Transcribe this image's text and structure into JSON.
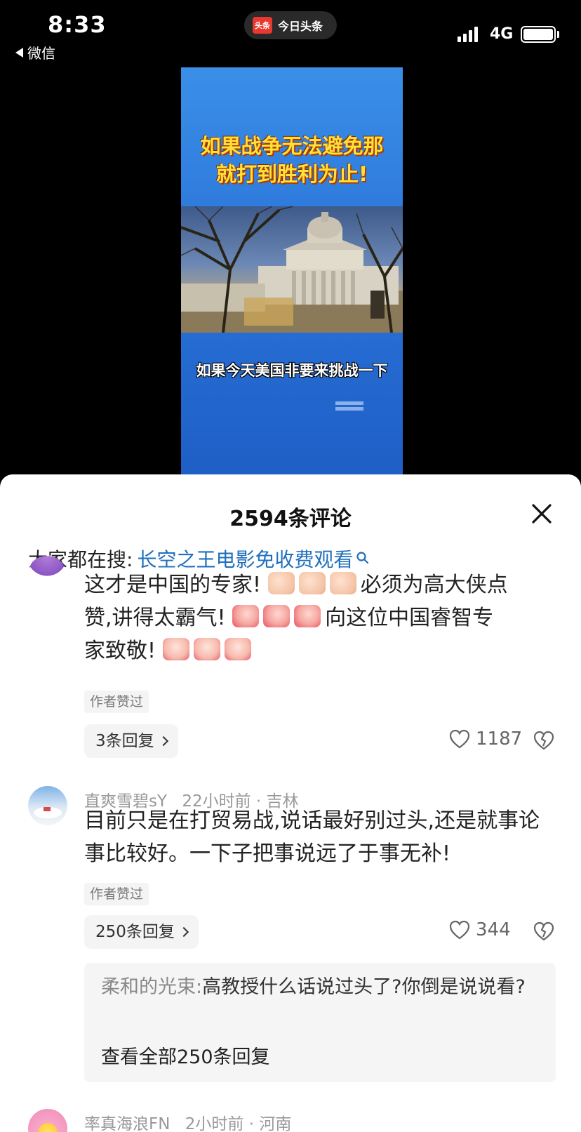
{
  "status_bar": {
    "time": "8:33",
    "back_app": "微信",
    "app_name": "今日头条",
    "app_logo_text": "头条",
    "network": "4G"
  },
  "video": {
    "headline_line1": "如果战争无法避免那",
    "headline_line2": "就打到胜利为止!",
    "subtitle": "如果今天美国非要来挑战一下"
  },
  "comments_sheet": {
    "title": "2594条评论",
    "search_label": "大家都在搜:",
    "search_link": "长空之王电影免收费观看",
    "comments": [
      {
        "text_line1": "这才是中国的专家!",
        "text_line1b": "必须为高大侠点",
        "text_line2a": "赞,讲得太霸气!",
        "text_line2b": "向这位中国睿智专",
        "text_line3": "家致敬!",
        "author_liked": "作者赞过",
        "replies": "3条回复",
        "likes": "1187"
      },
      {
        "username": "直爽雪碧sY",
        "time": "22小时前 · 吉林",
        "text": "目前只是在打贸易战,说话最好别过头,还是就事论事比较好。一下子把事说远了于事无补!",
        "author_liked": "作者赞过",
        "replies": "250条回复",
        "likes": "344",
        "reply_preview": {
          "name": "柔和的光束",
          "separator": ":",
          "text": "高教授什么话说过头了?你倒是说说看?",
          "view_all": "查看全部250条回复"
        }
      },
      {
        "username": "率真海浪FN",
        "time": "2小时前 · 河南"
      }
    ]
  }
}
